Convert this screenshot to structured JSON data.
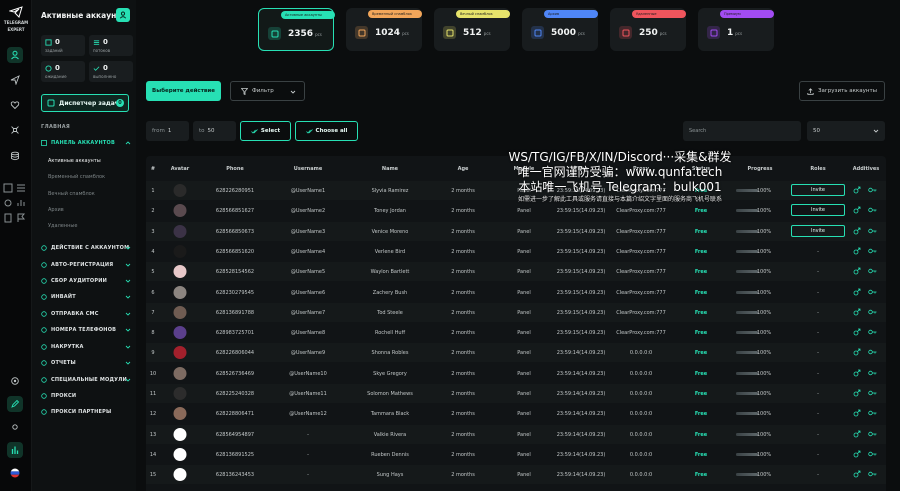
{
  "app": {
    "logo_text_1": "TELEGRAM",
    "logo_text_2": "EXPERT"
  },
  "sidebar": {
    "title": "Активные аккаунты",
    "stats": [
      {
        "value": "0",
        "label": "заданий",
        "icon": "task-icon"
      },
      {
        "value": "0",
        "label": "потоков",
        "icon": "threads-icon"
      },
      {
        "value": "0",
        "label": "ожидание",
        "icon": "wait-icon"
      },
      {
        "value": "0",
        "label": "выполнено",
        "icon": "done-icon"
      }
    ],
    "dispatcher_label": "Диспетчер задач",
    "dispatcher_badge": "0",
    "section_label": "ГЛАВНАЯ",
    "accounts_panel": "ПАНЕЛЬ АККАУНТОВ",
    "sub_items": [
      "Активные аккаунты",
      "Временный спамблок",
      "Вечный спамблок",
      "Архив",
      "Удаленные"
    ],
    "menu": [
      "ДЕЙСТВИЕ С АККАУНТОМ",
      "АВТО-РЕГИСТРАЦИЯ",
      "СБОР АУДИТОРИИ",
      "ИНВАЙТ",
      "ОТПРАВКА СМС",
      "НОМЕРА ТЕЛЕФОНОВ",
      "НАКРУТКА",
      "ОТЧЕТЫ",
      "СПЕЦИАЛЬНЫЕ МОДУЛИ",
      "ПРОКСИ",
      "ПРОКСИ ПАРТНЕРЫ"
    ]
  },
  "cards": [
    {
      "tag": "Активные аккаунты",
      "value": "2356",
      "unit": "pcs",
      "color": "#27e0b4"
    },
    {
      "tag": "Временный спамблок",
      "value": "1024",
      "unit": "pcs",
      "color": "#f2a65a"
    },
    {
      "tag": "Вечный спамблок",
      "value": "512",
      "unit": "pcs",
      "color": "#e6e36b"
    },
    {
      "tag": "Архив",
      "value": "5000",
      "unit": "pcs",
      "color": "#4f86f7"
    },
    {
      "tag": "Удаленные",
      "value": "250",
      "unit": "pcs",
      "color": "#f0555d"
    },
    {
      "tag": "Премиум",
      "value": "1",
      "unit": "pcs",
      "color": "#a24cf2"
    }
  ],
  "toolbar": {
    "action_button": "Выберите действие",
    "filter_button": "Фильтр",
    "upload_button": "Загрузить аккаунты",
    "from_placeholder": "from",
    "from_value": "1",
    "to_placeholder": "to",
    "to_value": "50",
    "select_button": "Select",
    "choose_all_button": "Choose all",
    "search_placeholder": "Search",
    "page_size": "50"
  },
  "table": {
    "headers": [
      "#",
      "Avatar",
      "Phone",
      "Username",
      "Name",
      "Age",
      "Module",
      "Time",
      "Proxy",
      "Status",
      "Progress",
      "Roles",
      "Additives"
    ],
    "rows": [
      {
        "n": "1",
        "phone": "628226280951",
        "user": "@UserName1",
        "name": "Slyvia Ramirez",
        "age": "2 months",
        "module": "Panel",
        "time": "23:59:15(14.09.23)",
        "proxy": "ClearProxy.com:777",
        "status": "Free",
        "progress": "100%",
        "role": "Invite",
        "avatar": "#2a2a2a"
      },
      {
        "n": "2",
        "phone": "628566851627",
        "user": "@UserName2",
        "name": "Toney Jordan",
        "age": "2 months",
        "module": "Panel",
        "time": "23:59:15(14.09.23)",
        "proxy": "ClearProxy.com:777",
        "status": "Free",
        "progress": "100%",
        "role": "Invite",
        "avatar": "#5a4a4f"
      },
      {
        "n": "3",
        "phone": "628566850673",
        "user": "@UserName3",
        "name": "Venice Moreno",
        "age": "2 months",
        "module": "Panel",
        "time": "23:59:15(14.09.23)",
        "proxy": "ClearProxy.com:777",
        "status": "Free",
        "progress": "100%",
        "role": "Invite",
        "avatar": "#3b3246"
      },
      {
        "n": "4",
        "phone": "628566851620",
        "user": "@UserName4",
        "name": "Verlene Bird",
        "age": "2 months",
        "module": "Panel",
        "time": "23:59:15(14.09.23)",
        "proxy": "ClearProxy.com:777",
        "status": "Free",
        "progress": "100%",
        "role": "-",
        "avatar": "#1a1a1a"
      },
      {
        "n": "5",
        "phone": "628528154562",
        "user": "@UserName5",
        "name": "Waylon Bartlett",
        "age": "2 months",
        "module": "Panel",
        "time": "23:59:15(14.09.23)",
        "proxy": "ClearProxy.com:777",
        "status": "Free",
        "progress": "100%",
        "role": "-",
        "avatar": "#e7c8c9"
      },
      {
        "n": "6",
        "phone": "628230279545",
        "user": "@UserName6",
        "name": "Zachery Bush",
        "age": "2 months",
        "module": "Panel",
        "time": "23:59:15(14.09.23)",
        "proxy": "ClearProxy.com:777",
        "status": "Free",
        "progress": "100%",
        "role": "-",
        "avatar": "#8c8580"
      },
      {
        "n": "7",
        "phone": "628136891788",
        "user": "@UserName7",
        "name": "Tod Steele",
        "age": "2 months",
        "module": "Panel",
        "time": "23:59:15(14.09.23)",
        "proxy": "ClearProxy.com:777",
        "status": "Free",
        "progress": "100%",
        "role": "-",
        "avatar": "#6f5c52"
      },
      {
        "n": "8",
        "phone": "628983725701",
        "user": "@UserName8",
        "name": "Rochell Huff",
        "age": "2 months",
        "module": "Panel",
        "time": "23:59:15(14.09.23)",
        "proxy": "ClearProxy.com:777",
        "status": "Free",
        "progress": "100%",
        "role": "-",
        "avatar": "#5b3f8c"
      },
      {
        "n": "9",
        "phone": "628226806044",
        "user": "@UserName9",
        "name": "Shonna Robles",
        "age": "2 months",
        "module": "Panel",
        "time": "23:59:14(14.09.23)",
        "proxy": "0.0.0.0:0",
        "status": "Free",
        "progress": "100%",
        "role": "-",
        "avatar": "#a3202c"
      },
      {
        "n": "10",
        "phone": "628526736469",
        "user": "@UserName10",
        "name": "Skye Gregory",
        "age": "2 months",
        "module": "Panel",
        "time": "23:59:14(14.09.23)",
        "proxy": "0.0.0.0:0",
        "status": "Free",
        "progress": "100%",
        "role": "-",
        "avatar": "#7d6b62"
      },
      {
        "n": "11",
        "phone": "628225240328",
        "user": "@UserName11",
        "name": "Solomon Mathews",
        "age": "2 months",
        "module": "Panel",
        "time": "23:59:14(14.09.23)",
        "proxy": "0.0.0.0:0",
        "status": "Free",
        "progress": "100%",
        "role": "-",
        "avatar": "#2c2c2c"
      },
      {
        "n": "12",
        "phone": "628228806471",
        "user": "@UserName12",
        "name": "Tammara Black",
        "age": "2 months",
        "module": "Panel",
        "time": "23:59:14(14.09.23)",
        "proxy": "0.0.0.0:0",
        "status": "Free",
        "progress": "100%",
        "role": "-",
        "avatar": "#8a6a5a"
      },
      {
        "n": "13",
        "phone": "628564954897",
        "user": "-",
        "name": "Valkie Rivera",
        "age": "2 months",
        "module": "Panel",
        "time": "23:59:14(14.09.23)",
        "proxy": "0.0.0.0:0",
        "status": "Free",
        "progress": "100%",
        "role": "-",
        "avatar": "#ffffff"
      },
      {
        "n": "14",
        "phone": "628136891525",
        "user": "-",
        "name": "Rueben Dennis",
        "age": "2 months",
        "module": "Panel",
        "time": "23:59:14(14.09.23)",
        "proxy": "0.0.0.0:0",
        "status": "Free",
        "progress": "100%",
        "role": "-",
        "avatar": "#ffffff"
      },
      {
        "n": "15",
        "phone": "628136243453",
        "user": "-",
        "name": "Sung Hays",
        "age": "2 months",
        "module": "Panel",
        "time": "23:59:14(14.09.23)",
        "proxy": "0.0.0.0:0",
        "status": "Free",
        "progress": "100%",
        "role": "-",
        "avatar": "#ffffff"
      }
    ]
  },
  "overlay": {
    "line1": "WS/TG/IG/FB/X/IN/Discord···采集&群发",
    "line2": "唯一官网谨防受骗：www.qunfa.tech",
    "line3": "本站唯一飞机号 Telegram：bulk001",
    "line4": "如需进一步了解此工具或服务请直接与本篇介绍文字里面的服务商飞机号联系"
  }
}
